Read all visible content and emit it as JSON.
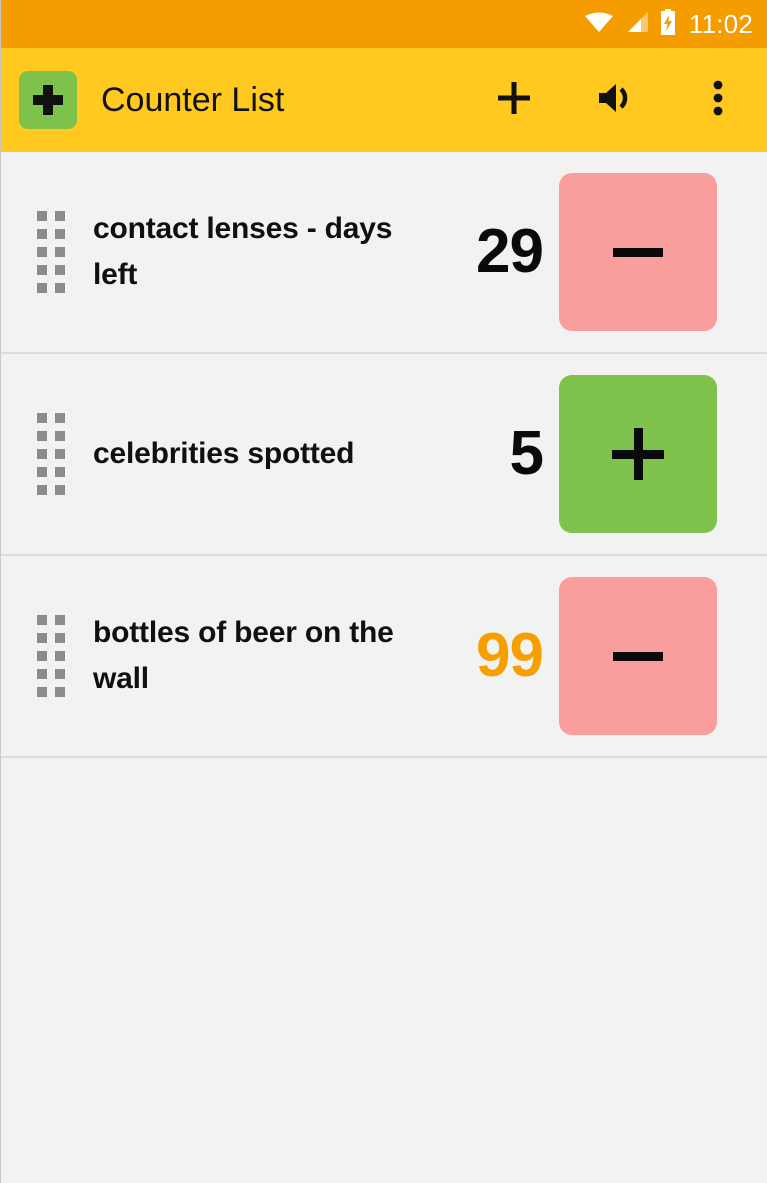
{
  "status_bar": {
    "time": "11:02",
    "icons": [
      "wifi-icon",
      "cellular-signal-icon",
      "battery-charging-icon"
    ],
    "background_color": "#F59C00"
  },
  "app_bar": {
    "title": "Counter List",
    "app_icon": "plus-app-icon",
    "background_color": "#FFC920",
    "actions": [
      {
        "name": "add-counter-button",
        "icon": "plus-icon"
      },
      {
        "name": "volume-button",
        "icon": "volume-icon"
      },
      {
        "name": "overflow-menu-button",
        "icon": "more-vertical-icon"
      }
    ]
  },
  "colors": {
    "decrement_button": "#FA9D9D",
    "increment_button": "#7EC24C",
    "highlight_value": "#F5A000",
    "background": "#F2F2F2"
  },
  "counters": [
    {
      "label": "contact lenses - days left",
      "value": "29",
      "value_color": "default",
      "button": {
        "action": "decrement",
        "symbol": "minus-icon"
      }
    },
    {
      "label": "celebrities spotted",
      "value": "5",
      "value_color": "default",
      "button": {
        "action": "increment",
        "symbol": "plus-icon"
      }
    },
    {
      "label": "bottles of beer on the wall",
      "value": "99",
      "value_color": "highlight",
      "button": {
        "action": "decrement",
        "symbol": "minus-icon"
      }
    }
  ]
}
